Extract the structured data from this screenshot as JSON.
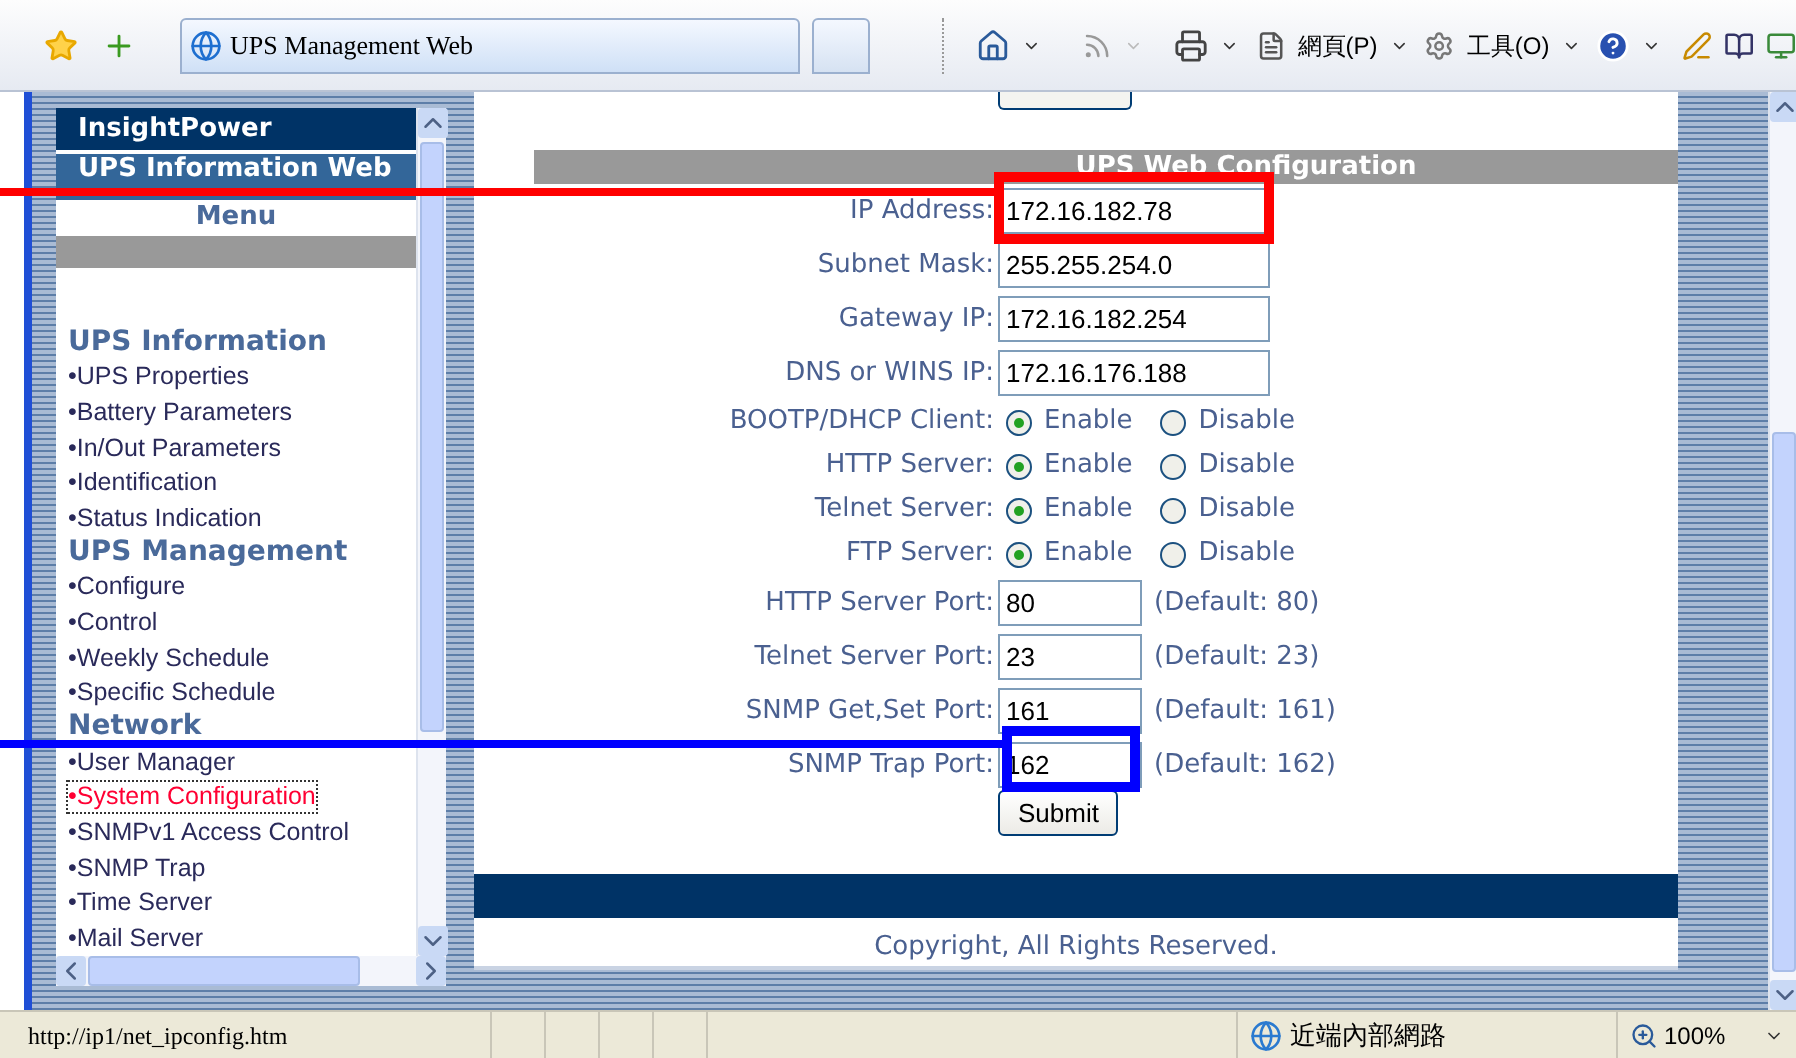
{
  "browser": {
    "tab_title": "UPS Management Web",
    "menus": [
      {
        "label": "網頁(P)"
      },
      {
        "label": "工具(O)"
      }
    ]
  },
  "left_frame": {
    "brand": "InsightPower",
    "subtitle": "UPS Information Web",
    "menu_title": "Menu",
    "groups": [
      {
        "title": "UPS Information",
        "items": [
          {
            "label": "•UPS Properties",
            "selected": false
          },
          {
            "label": "•Battery Parameters",
            "selected": false
          },
          {
            "label": "•In/Out Parameters",
            "selected": false
          },
          {
            "label": "•Identification",
            "selected": false
          },
          {
            "label": "•Status Indication",
            "selected": false
          }
        ]
      },
      {
        "title": "UPS Management",
        "items": [
          {
            "label": "•Configure",
            "selected": false
          },
          {
            "label": "•Control",
            "selected": false
          },
          {
            "label": "•Weekly Schedule",
            "selected": false
          },
          {
            "label": "•Specific Schedule",
            "selected": false
          }
        ]
      },
      {
        "title": "Network",
        "items": [
          {
            "label": "•User Manager",
            "selected": false
          },
          {
            "label": "•System Configuration",
            "selected": true
          },
          {
            "label": "•SNMPv1 Access Control",
            "selected": false
          },
          {
            "label": "•SNMP Trap",
            "selected": false
          },
          {
            "label": "•Time Server",
            "selected": false
          },
          {
            "label": "•Mail Server",
            "selected": false
          }
        ]
      }
    ]
  },
  "form": {
    "title": "UPS Web Configuration",
    "fields": [
      {
        "label": "IP Address:",
        "value": "172.16.182.78"
      },
      {
        "label": "Subnet Mask:",
        "value": "255.255.254.0"
      },
      {
        "label": "Gateway IP:",
        "value": "172.16.182.254"
      },
      {
        "label": "DNS or WINS IP:",
        "value": "172.16.176.188"
      }
    ],
    "radios": [
      {
        "label": "BOOTP/DHCP Client:",
        "options": [
          {
            "label": "Enable",
            "selected": true
          },
          {
            "label": "Disable",
            "selected": false
          }
        ]
      },
      {
        "label": "HTTP Server:",
        "options": [
          {
            "label": "Enable",
            "selected": true
          },
          {
            "label": "Disable",
            "selected": false
          }
        ]
      },
      {
        "label": "Telnet Server:",
        "options": [
          {
            "label": "Enable",
            "selected": true
          },
          {
            "label": "Disable",
            "selected": false
          }
        ]
      },
      {
        "label": "FTP Server:",
        "options": [
          {
            "label": "Enable",
            "selected": true
          },
          {
            "label": "Disable",
            "selected": false
          }
        ]
      }
    ],
    "ports": [
      {
        "label": "HTTP Server Port:",
        "value": "80",
        "hint": "(Default: 80)"
      },
      {
        "label": "Telnet Server Port:",
        "value": "23",
        "hint": "(Default: 23)"
      },
      {
        "label": "SNMP Get,Set Port:",
        "value": "161",
        "hint": "(Default: 161)"
      },
      {
        "label": "SNMP Trap Port:",
        "value": "162",
        "hint": "(Default: 162)"
      }
    ],
    "submit": "Submit"
  },
  "footer": "Copyright, All Rights Reserved.",
  "status_bar": {
    "url": "http://ip1/net_ipconfig.htm",
    "zone": "近端內部網路",
    "zoom": "100%"
  },
  "annotations": [
    {
      "color": "#ff0000"
    },
    {
      "color": "#0000ff"
    }
  ]
}
